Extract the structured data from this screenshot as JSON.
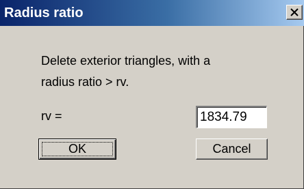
{
  "window": {
    "title": "Radius ratio",
    "close_icon": "close-icon"
  },
  "message": {
    "line1": "Delete exterior triangles, with a",
    "line2": "radius ratio > rv."
  },
  "rv_field": {
    "label": "rv =",
    "value": "1834.79"
  },
  "buttons": {
    "ok_label": "OK",
    "cancel_label": "Cancel"
  },
  "colors": {
    "titlebar_start": "#0a246a",
    "titlebar_end": "#a6caf0",
    "dialog_face": "#d4d0c8"
  }
}
